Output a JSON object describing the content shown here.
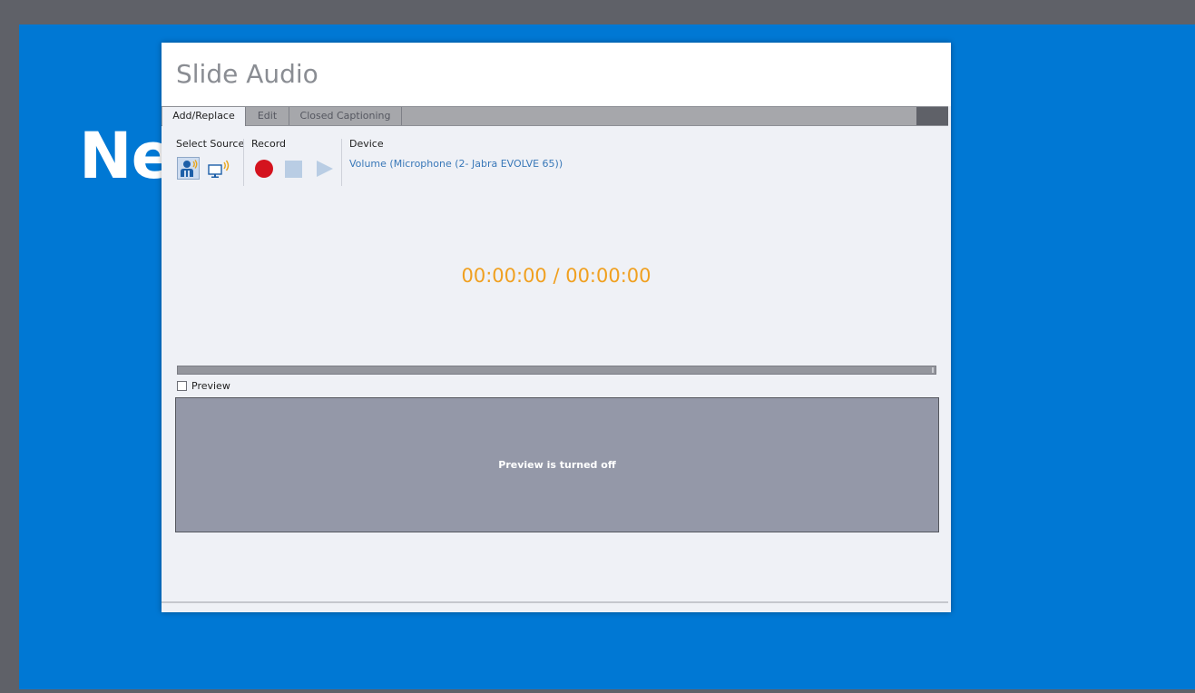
{
  "slide": {
    "title": "Ne"
  },
  "dialog": {
    "title": "Slide Audio",
    "tabs": [
      {
        "label": "Add/Replace",
        "active": true
      },
      {
        "label": "Edit",
        "active": false
      },
      {
        "label": "Closed Captioning",
        "active": false
      }
    ],
    "select_source_label": "Select Source",
    "record_label": "Record",
    "device_label": "Device",
    "device_value": "Volume (Microphone (2- Jabra EVOLVE 65))",
    "timer": "00:00:00 / 00:00:00",
    "preview_label": "Preview",
    "preview_checked": false,
    "preview_message": "Preview is turned off",
    "icons": {
      "source_mic": "microphone-person-icon",
      "source_system": "system-audio-icon",
      "record": "record-icon",
      "stop": "stop-icon",
      "play": "play-icon"
    },
    "colors": {
      "slide_background": "#0078d4",
      "timer": "#f0a020",
      "record": "#d4131e",
      "device_link": "#3978b8"
    }
  }
}
